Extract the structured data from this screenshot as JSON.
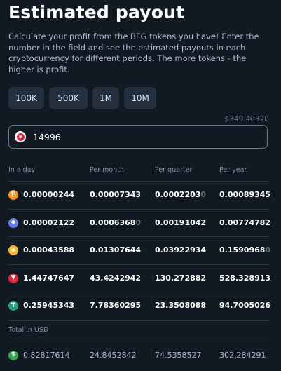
{
  "header": {
    "title": "Estimated payout",
    "description": "Calculate your profit from the BFG tokens you have! Enter the number in the field and see the estimated payouts in each cryptocurrency for different periods. The more tokens - the higher is profit."
  },
  "presets": [
    "100K",
    "500K",
    "1M",
    "10M"
  ],
  "input": {
    "usd_balance": "$349.40320",
    "value": "14996"
  },
  "table": {
    "headers": [
      "In a day",
      "Per month",
      "Per quarter",
      "Per year"
    ],
    "rows": [
      {
        "icon": "bitcoin-icon",
        "color": "#f7931a",
        "glyph": "₿",
        "values": [
          {
            "main": "0.00000244",
            "faded": ""
          },
          {
            "main": "0.00007343",
            "faded": ""
          },
          {
            "main": "0.0002203",
            "faded": "0"
          },
          {
            "main": "0.00089345",
            "faded": ""
          }
        ]
      },
      {
        "icon": "ethereum-icon",
        "color": "#627eea",
        "glyph": "◆",
        "values": [
          {
            "main": "0.00002122",
            "faded": ""
          },
          {
            "main": "0.0006368",
            "faded": "0"
          },
          {
            "main": "0.00191042",
            "faded": ""
          },
          {
            "main": "0.00774782",
            "faded": ""
          }
        ]
      },
      {
        "icon": "bnb-icon",
        "color": "#f3ba2f",
        "glyph": "◈",
        "values": [
          {
            "main": "0.00043588",
            "faded": ""
          },
          {
            "main": "0.01307644",
            "faded": ""
          },
          {
            "main": "0.03922934",
            "faded": ""
          },
          {
            "main": "0.1590968",
            "faded": "0"
          }
        ]
      },
      {
        "icon": "tron-icon",
        "color": "#e0243a",
        "glyph": "▼",
        "values": [
          {
            "main": "1.44747647",
            "faded": ""
          },
          {
            "main": "43.4242942",
            "faded": ""
          },
          {
            "main": "130.272882",
            "faded": ""
          },
          {
            "main": "528.328913",
            "faded": ""
          }
        ]
      },
      {
        "icon": "tether-icon",
        "color": "#26a17b",
        "glyph": "T",
        "values": [
          {
            "main": "0.25945343",
            "faded": ""
          },
          {
            "main": "7.78360295",
            "faded": ""
          },
          {
            "main": "23.3508088",
            "faded": ""
          },
          {
            "main": "94.7005026",
            "faded": ""
          }
        ]
      }
    ],
    "total": {
      "label": "Total in USD",
      "icon": "dollar-icon",
      "color": "#2ea44f",
      "glyph": "$",
      "values": [
        "0.82817614",
        "24.8452842",
        "74.5358527",
        "302.284291"
      ]
    }
  }
}
